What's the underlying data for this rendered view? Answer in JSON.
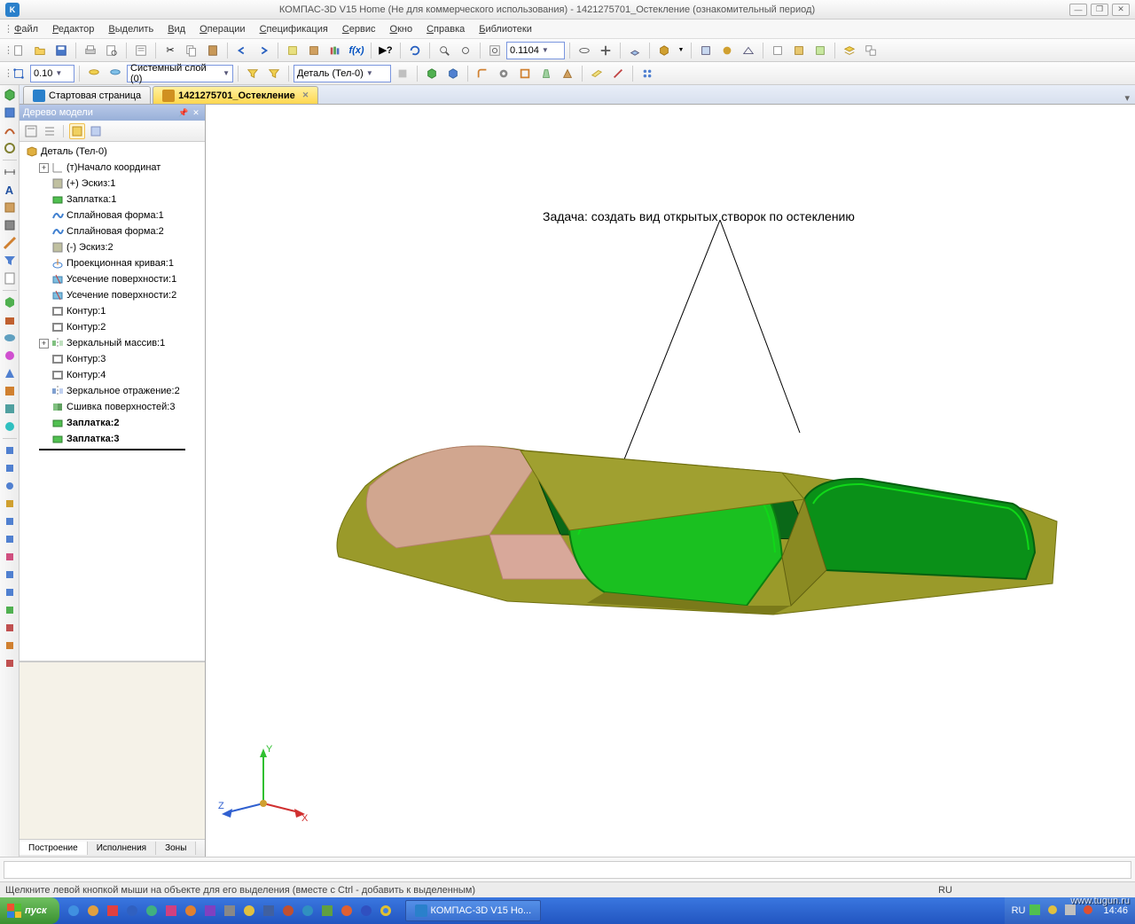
{
  "title": "КОМПАС-3D V15 Home (Не для коммерческого использования) - 1421275701_Остекление (ознакомительный период)",
  "menu": [
    "Файл",
    "Редактор",
    "Выделить",
    "Вид",
    "Операции",
    "Спецификация",
    "Сервис",
    "Окно",
    "Справка",
    "Библиотеки"
  ],
  "toolbar2": {
    "step": "0.10",
    "layer": "Системный слой (0)",
    "part": "Деталь (Тел-0)"
  },
  "zoom": "0.1104",
  "tabs": {
    "start": "Стартовая страница",
    "active": "1421275701_Остекление"
  },
  "panel": {
    "title": "Дерево модели",
    "root": "Деталь (Тел-0)",
    "items": [
      {
        "exp": "+",
        "icon": "origin",
        "label": "(т)Начало координат"
      },
      {
        "icon": "sketch",
        "label": "(+) Эскиз:1"
      },
      {
        "icon": "patch",
        "label": "Заплатка:1"
      },
      {
        "icon": "spline",
        "label": "Сплайновая форма:1"
      },
      {
        "icon": "spline",
        "label": "Сплайновая форма:2"
      },
      {
        "icon": "sketch",
        "label": "(-) Эскиз:2"
      },
      {
        "icon": "proj",
        "label": "Проекционная кривая:1"
      },
      {
        "icon": "trim",
        "label": "Усечение поверхности:1"
      },
      {
        "icon": "trim",
        "label": "Усечение поверхности:2"
      },
      {
        "icon": "contour",
        "label": "Контур:1"
      },
      {
        "icon": "contour",
        "label": "Контур:2"
      },
      {
        "exp": "+",
        "icon": "mirror",
        "label": "Зеркальный массив:1"
      },
      {
        "icon": "contour",
        "label": "Контур:3"
      },
      {
        "icon": "contour",
        "label": "Контур:4"
      },
      {
        "icon": "mirror2",
        "label": "Зеркальное отражение:2"
      },
      {
        "icon": "stitch",
        "label": "Сшивка поверхностей:3"
      },
      {
        "icon": "patch2",
        "label": "Заплатка:2",
        "bold": true
      },
      {
        "icon": "patch2",
        "label": "Заплатка:3",
        "bold": true
      }
    ],
    "bottomtabs": [
      "Построение",
      "Исполнения",
      "Зоны"
    ]
  },
  "annotation": "Задача: создать вид открытых створок по остеклению",
  "axes": {
    "x": "X",
    "y": "Y",
    "z": "Z"
  },
  "status": "Щелкните левой кнопкой мыши на объекте для его выделения (вместе с Ctrl - добавить к выделенным)",
  "status_lang": "RU",
  "taskbar": {
    "start": "пуск",
    "active": "КОМПАС-3D V15 Ho...",
    "clock": "14:46",
    "watermark": "www.tugun.ru"
  }
}
